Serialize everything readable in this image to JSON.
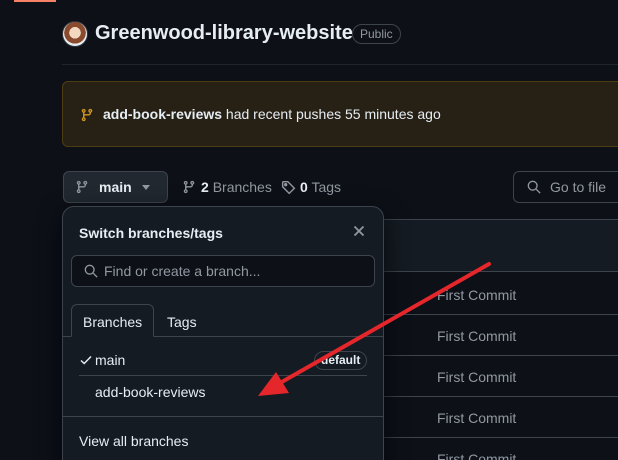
{
  "repo": {
    "name": "Greenwood-library-website",
    "visibility": "Public",
    "avatar": "user-avatar"
  },
  "push_banner": {
    "branch": "add-book-reviews",
    "message": "had recent pushes 55 minutes ago",
    "icon": "git-branch-icon"
  },
  "toolbar": {
    "current_branch": "main",
    "branch_count": "2",
    "branches_label": "Branches",
    "tag_count": "0",
    "tags_label": "Tags",
    "goto_file": "Go to file"
  },
  "dropdown": {
    "title": "Switch branches/tags",
    "search_placeholder": "Find or create a branch...",
    "tabs": [
      "Branches",
      "Tags"
    ],
    "active_tab": "Branches",
    "items": [
      {
        "name": "main",
        "selected": true,
        "badge": "default"
      },
      {
        "name": "add-book-reviews",
        "selected": false,
        "badge": ""
      }
    ],
    "footer_link": "View all branches"
  },
  "file_list": {
    "commit_messages": [
      "First Commit",
      "First Commit",
      "First Commit",
      "First Commit",
      "First Commit"
    ]
  },
  "colors": {
    "background": "#0d1117",
    "banner_bg": "#272115",
    "banner_icon": "#d29922",
    "annotation_arrow": "#e5262b"
  }
}
